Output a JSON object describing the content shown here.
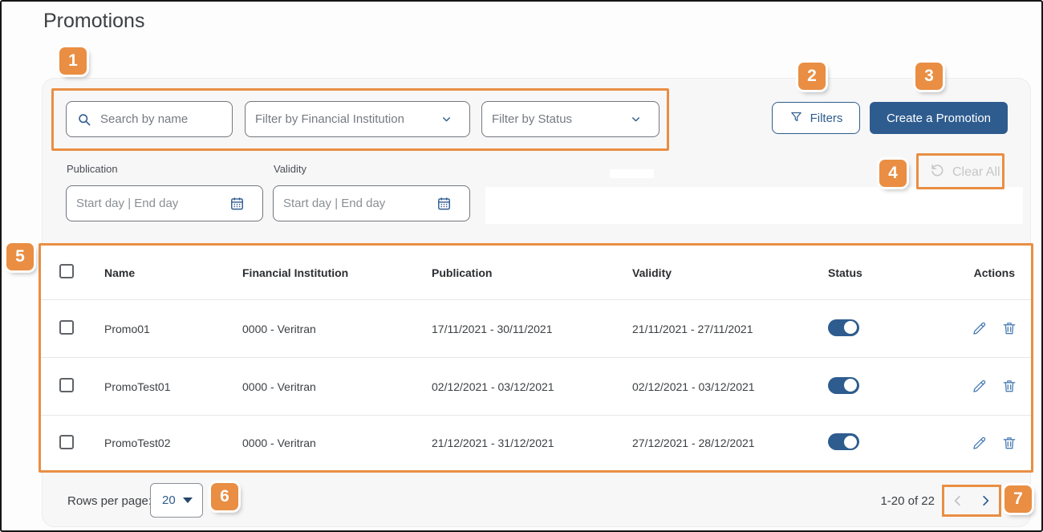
{
  "page": {
    "title": "Promotions"
  },
  "callouts": [
    "1",
    "2",
    "3",
    "4",
    "5",
    "6",
    "7"
  ],
  "filters": {
    "search_placeholder": "Search by name",
    "financial_institution_placeholder": "Filter by Financial Institution",
    "status_placeholder": "Filter by Status",
    "filters_button_label": "Filters",
    "create_button_label": "Create a Promotion",
    "clear_all_label": "Clear All",
    "publication_label": "Publication",
    "validity_label": "Validity",
    "date_range_placeholder": "Start day  |  End day"
  },
  "table": {
    "columns": {
      "name": "Name",
      "financial_institution": "Financial Institution",
      "publication": "Publication",
      "validity": "Validity",
      "status": "Status",
      "actions": "Actions"
    },
    "rows": [
      {
        "name": "Promo01",
        "financial_institution": "0000 - Veritran",
        "publication": "17/11/2021 - 30/11/2021",
        "validity": "21/11/2021 - 27/11/2021",
        "status_on": true
      },
      {
        "name": "PromoTest01",
        "financial_institution": "0000 - Veritran",
        "publication": "02/12/2021 - 03/12/2021",
        "validity": "02/12/2021 - 03/12/2021",
        "status_on": true
      },
      {
        "name": "PromoTest02",
        "financial_institution": "0000 - Veritran",
        "publication": "21/12/2021 - 31/12/2021",
        "validity": "27/12/2021 - 28/12/2021",
        "status_on": true
      }
    ]
  },
  "footer": {
    "rows_per_page_label": "Rows per page:",
    "rows_per_page_value": "20",
    "range_label": "1-20 of 22"
  },
  "colors": {
    "accent_orange": "#E98E43",
    "brand_blue": "#2E5C8F",
    "icon_blue": "#4D7FB5",
    "disabled_gray": "#C6C6C6",
    "panel_background": "#F7F7F8"
  }
}
